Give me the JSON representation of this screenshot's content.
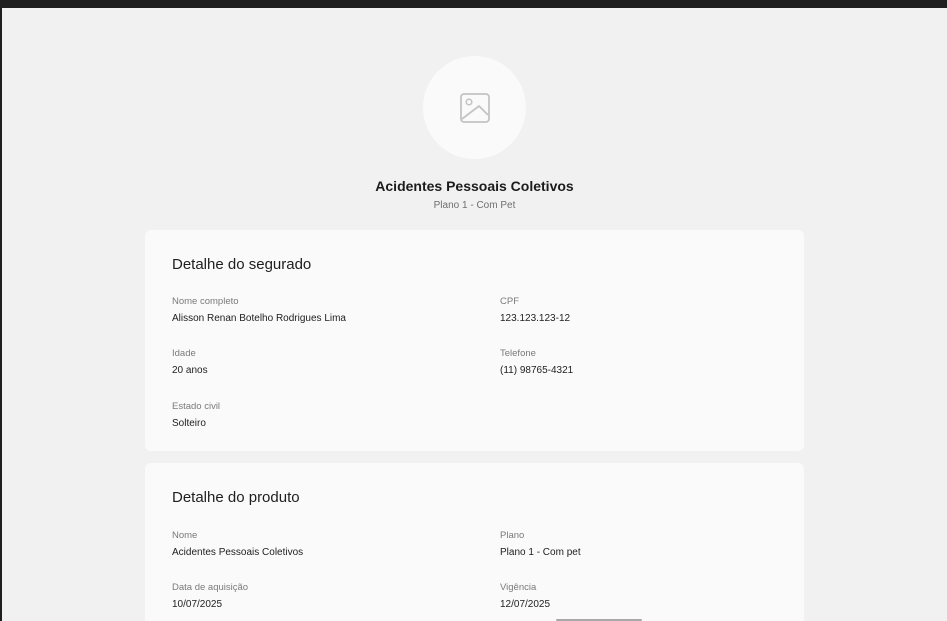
{
  "header": {
    "avatar_icon": "image-placeholder-icon",
    "product_title": "Acidentes Pessoais Coletivos",
    "product_subtitle": "Plano 1 - Com Pet"
  },
  "insured": {
    "title": "Detalhe do segurado",
    "fields": [
      {
        "label": "Nome completo",
        "value": "Alisson Renan Botelho Rodrigues Lima"
      },
      {
        "label": "CPF",
        "value": "123.123.123-12"
      },
      {
        "label": "Idade",
        "value": "20 anos"
      },
      {
        "label": "Telefone",
        "value": "(11) 98765-4321"
      },
      {
        "label": "Estado civil",
        "value": "Solteiro"
      }
    ]
  },
  "product": {
    "title": "Detalhe do produto",
    "fields": [
      {
        "label": "Nome",
        "value": "Acidentes Pessoais Coletivos"
      },
      {
        "label": "Plano",
        "value": "Plano 1 - Com pet"
      },
      {
        "label": "Data de aquisição",
        "value": "10/07/2025"
      },
      {
        "label": "Vigência",
        "value": "12/07/2025"
      }
    ]
  }
}
